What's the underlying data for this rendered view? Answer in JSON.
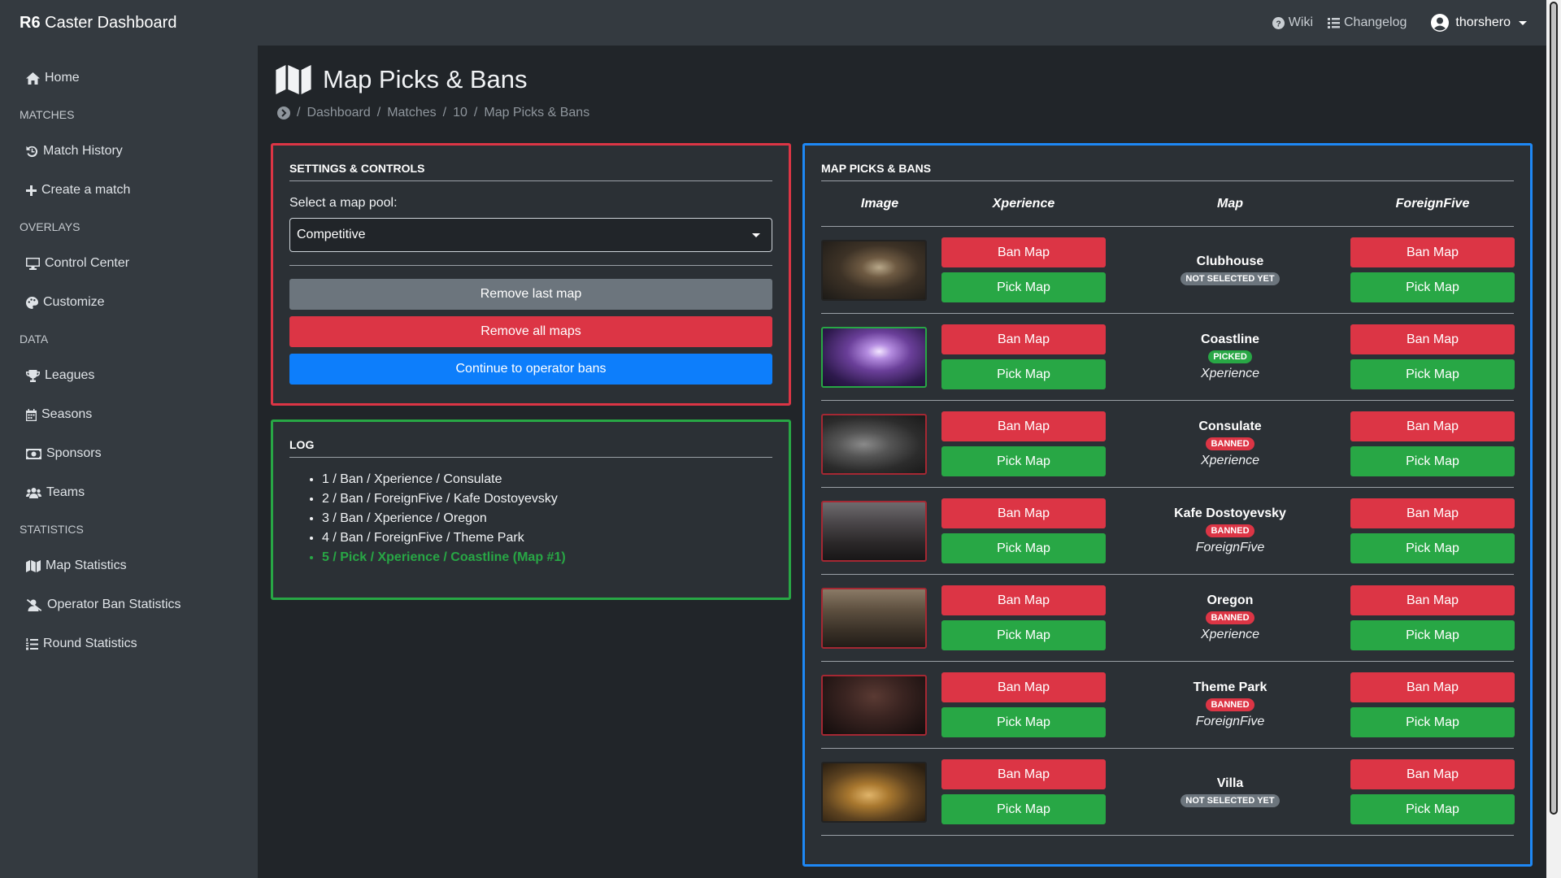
{
  "navbar": {
    "brand_bold": "R6",
    "brand_rest": "Caster Dashboard",
    "wiki": "Wiki",
    "changelog": "Changelog",
    "username": "thorshero"
  },
  "sidebar": {
    "home": "Home",
    "matches_heading": "MATCHES",
    "match_history": "Match History",
    "create_match": "Create a match",
    "overlays_heading": "OVERLAYS",
    "control_center": "Control Center",
    "customize": "Customize",
    "data_heading": "DATA",
    "leagues": "Leagues",
    "seasons": "Seasons",
    "sponsors": "Sponsors",
    "teams": "Teams",
    "statistics_heading": "STATISTICS",
    "map_statistics": "Map Statistics",
    "operator_ban_statistics": "Operator Ban Statistics",
    "round_statistics": "Round Statistics"
  },
  "page": {
    "title": "Map Picks & Bans",
    "breadcrumb": [
      "Dashboard",
      "Matches",
      "10",
      "Map Picks & Bans"
    ]
  },
  "settings": {
    "title": "SETTINGS & CONTROLS",
    "pool_label": "Select a map pool:",
    "pool_value": "Competitive",
    "remove_last": "Remove last map",
    "remove_all": "Remove all maps",
    "continue": "Continue to operator bans"
  },
  "log": {
    "title": "LOG",
    "entries": [
      "1 / Ban / Xperience / Consulate",
      "2 / Ban / ForeignFive / Kafe Dostoyevsky",
      "3 / Ban / Xperience / Oregon",
      "4 / Ban / ForeignFive / Theme Park",
      "5 / Pick / Xperience / Coastline (Map #1)"
    ]
  },
  "maps_card": {
    "title": "MAP PICKS & BANS",
    "headers": {
      "image": "Image",
      "team1": "Xperience",
      "map": "Map",
      "team2": "ForeignFive"
    },
    "ban_label": "Ban Map",
    "pick_label": "Pick Map",
    "rows": [
      {
        "name": "Clubhouse",
        "status": "NOT SELECTED YET",
        "by": ""
      },
      {
        "name": "Coastline",
        "status": "PICKED",
        "by": "Xperience"
      },
      {
        "name": "Consulate",
        "status": "BANNED",
        "by": "Xperience"
      },
      {
        "name": "Kafe Dostoyevsky",
        "status": "BANNED",
        "by": "ForeignFive"
      },
      {
        "name": "Oregon",
        "status": "BANNED",
        "by": "Xperience"
      },
      {
        "name": "Theme Park",
        "status": "BANNED",
        "by": "ForeignFive"
      },
      {
        "name": "Villa",
        "status": "NOT SELECTED YET",
        "by": ""
      }
    ]
  },
  "colors": {
    "danger": "#dc3545",
    "success": "#28a745",
    "primary": "#0d7efb",
    "secondary": "#6c757d"
  }
}
